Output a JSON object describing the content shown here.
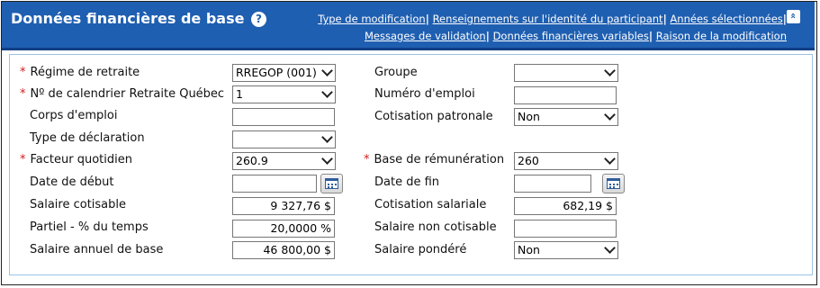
{
  "header": {
    "title": "Données financières de base",
    "help": "?",
    "links": [
      "Type de modification",
      "Renseignements sur l'identité du participant",
      "Années sélectionnées",
      "Messages de validation",
      "Données financières variables",
      "Raison de la modification"
    ],
    "separator": "|",
    "collapse_glyph": "«"
  },
  "colors": {
    "header": "#1f5fb1",
    "required": "#d21b1b",
    "panel_border": "#9cc3e6"
  },
  "required_marker": "*",
  "left": {
    "regime_label": "Régime de retraite",
    "regime_value": "RREGOP (001)",
    "calendrier_label": "Nº de calendrier Retraite Québec",
    "calendrier_value": "1",
    "corps_label": "Corps d'emploi",
    "corps_value": "",
    "type_decl_label": "Type de déclaration",
    "type_decl_value": "",
    "facteur_label": "Facteur quotidien",
    "facteur_value": "260.9",
    "date_debut_label": "Date de début",
    "date_debut_value": "",
    "salaire_cot_label": "Salaire cotisable",
    "salaire_cot_value": "9 327,76 $",
    "partiel_label": "Partiel - % du temps",
    "partiel_value": "20,0000 %",
    "salaire_annuel_label": "Salaire annuel de base",
    "salaire_annuel_value": "46 800,00 $"
  },
  "right": {
    "groupe_label": "Groupe",
    "groupe_value": "",
    "numero_label": "Numéro d'emploi",
    "numero_value": "",
    "cot_patronale_label": "Cotisation patronale",
    "cot_patronale_value": "Non",
    "base_rem_label": "Base de rémunération",
    "base_rem_value": "260",
    "date_fin_label": "Date de fin",
    "date_fin_value": "",
    "cot_salariale_label": "Cotisation salariale",
    "cot_salariale_value": "682,19 $",
    "salaire_non_cot_label": "Salaire non cotisable",
    "salaire_non_cot_value": "",
    "salaire_pondere_label": "Salaire pondéré",
    "salaire_pondere_value": "Non"
  }
}
